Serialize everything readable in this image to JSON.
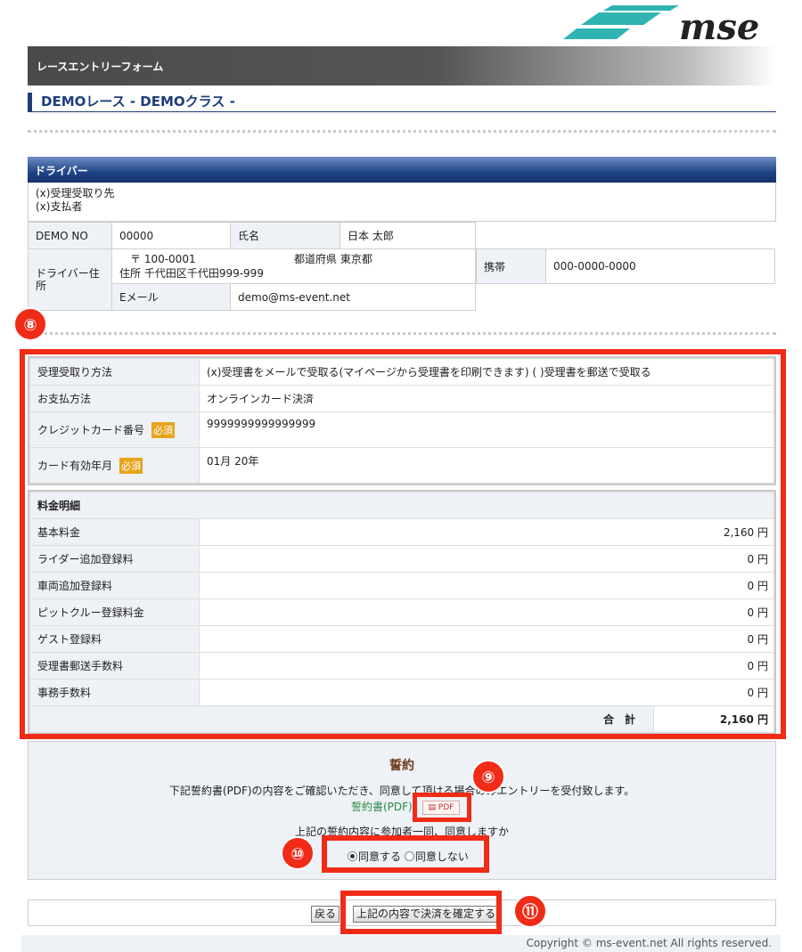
{
  "header": {
    "title": "レースエントリーフォーム"
  },
  "race": {
    "title": "DEMOレース - DEMOクラス -"
  },
  "driver": {
    "section_title": "ドライバー",
    "lines": [
      "(x)受理受取り先",
      "(x)支払者"
    ],
    "no_label": "DEMO NO",
    "no_value": "00000",
    "name_label": "氏名",
    "name_value": "日本 太郎",
    "addr_label": "ドライバー住所",
    "postal": "〒 100-0001",
    "pref": "都道府県 東京都",
    "address": "住所 千代田区千代田999-999",
    "email_label": "Eメール",
    "email_value": "demo@ms-event.net",
    "phone_label": "携帯",
    "phone_value": "000-0000-0000"
  },
  "payment": {
    "receipt_label": "受理受取り方法",
    "receipt_value": "(x)受理書をメールで受取る(マイページから受理書を印刷できます) ( )受理書を郵送で受取る",
    "method_label": "お支払方法",
    "method_value": "オンラインカード決済",
    "card_label": "クレジットカード番号",
    "card_value": "9999999999999999",
    "required": "必須",
    "expiry_label": "カード有効年月",
    "expiry_value": "01月 20年"
  },
  "fees": {
    "title": "料金明細",
    "rows": [
      {
        "label": "基本料金",
        "amount": "2,160 円"
      },
      {
        "label": "ライダー追加登録料",
        "amount": "0 円"
      },
      {
        "label": "車両追加登録料",
        "amount": "0 円"
      },
      {
        "label": "ピットクルー登録料金",
        "amount": "0 円"
      },
      {
        "label": "ゲスト登録料",
        "amount": "0 円"
      },
      {
        "label": "受理書郵送手数料",
        "amount": "0 円"
      },
      {
        "label": "事務手数料",
        "amount": "0 円"
      }
    ],
    "total_label": "合　計",
    "total_value": "2,160 円"
  },
  "oath": {
    "title": "誓約",
    "text": "下記誓約書(PDF)の内容をご確認いただき、同意して頂ける場合のみエントリーを受付致します。",
    "pdf_link": "誓約書(PDF)",
    "pdf_btn": "PDF",
    "question": "上記の誓約内容に参加者一同、同意しますか",
    "agree": "同意する",
    "disagree": "同意しない"
  },
  "buttons": {
    "back": "戻る",
    "confirm": "上記の内容で決済を確定する"
  },
  "annotations": {
    "c8": "⑧",
    "c9": "⑨",
    "c10": "⑩",
    "c11": "⑪"
  },
  "footer": {
    "copyright": "Copyright © ms-event.net All rights reserved."
  },
  "logo": {
    "text": "mse"
  },
  "colors": {
    "accent": "#f02b17",
    "navy": "#1d3d7a"
  }
}
